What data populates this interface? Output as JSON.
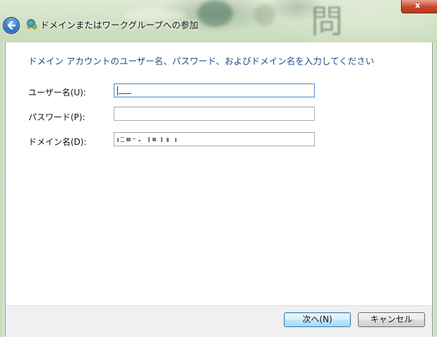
{
  "window": {
    "title": "ドメインまたはワークグループへの参加",
    "close_label": "x"
  },
  "instruction": "ドメイン アカウントのユーザー名、パスワード、およびドメイン名を入力してください",
  "fields": {
    "username": {
      "label": "ユーザー名(U):",
      "value": ""
    },
    "password": {
      "label": "パスワード(P):",
      "value": ""
    },
    "domain": {
      "label": "ドメイン名(D):",
      "value": ""
    }
  },
  "buttons": {
    "next": "次へ(N)",
    "cancel": "キャンセル"
  },
  "icons": {
    "back": "back-arrow-icon",
    "title": "network-globe-icon"
  },
  "colors": {
    "instruction_text": "#1a4e8c",
    "focus_border": "#5b9bd5",
    "default_button_border": "#3c7fb1"
  }
}
